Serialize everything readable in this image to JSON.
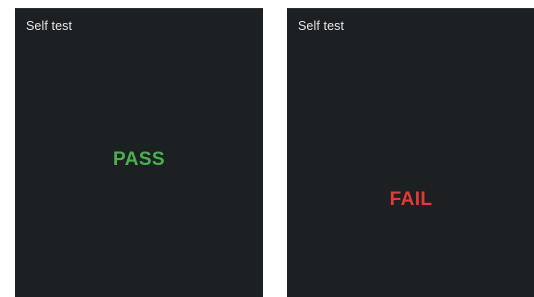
{
  "screens": [
    {
      "title": "Self test",
      "result": "PASS",
      "result_color": "#4caf50"
    },
    {
      "title": "Self test",
      "result": "FAIL",
      "result_color": "#e53935"
    }
  ],
  "colors": {
    "screen_background": "#1d2023",
    "title_text": "#e6e6e6",
    "page_background": "#ffffff"
  }
}
